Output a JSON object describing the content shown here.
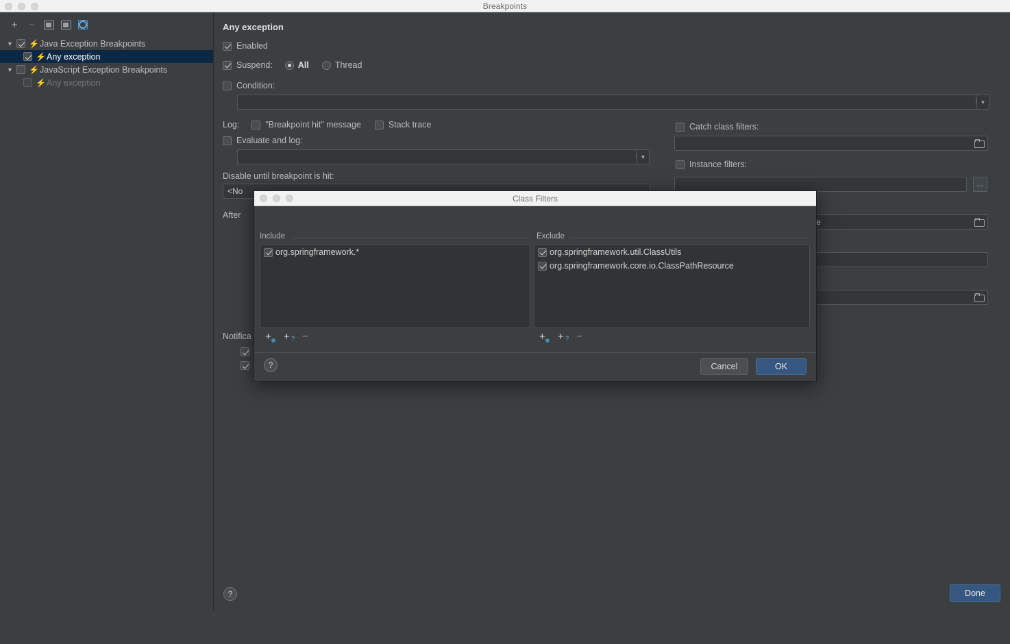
{
  "window": {
    "title": "Breakpoints",
    "traffic_lights": [
      "close-dot",
      "minimize-dot",
      "maximize-dot"
    ],
    "done_label": "Done",
    "help_label": "?"
  },
  "sidebar": {
    "toolbar": [
      {
        "name": "add-breakpoint-button",
        "glyph": "+"
      },
      {
        "name": "remove-breakpoint-button",
        "glyph": "−"
      },
      {
        "name": "group-by-icon",
        "glyph": ""
      },
      {
        "name": "save-icon",
        "glyph": ""
      },
      {
        "name": "view-options-icon",
        "glyph": ""
      }
    ],
    "tree": [
      {
        "label": "Java Exception Breakpoints",
        "level": 0,
        "expanded": true,
        "checked": true,
        "selected": false,
        "enabled": true
      },
      {
        "label": "Any exception",
        "level": 1,
        "expanded": false,
        "checked": true,
        "selected": true,
        "enabled": true
      },
      {
        "label": "JavaScript Exception Breakpoints",
        "level": 0,
        "expanded": true,
        "checked": false,
        "selected": false,
        "enabled": true
      },
      {
        "label": "Any exception",
        "level": 1,
        "expanded": false,
        "checked": false,
        "selected": false,
        "enabled": false
      }
    ]
  },
  "detail": {
    "title": "Any exception",
    "enabled": {
      "label": "Enabled",
      "checked": true
    },
    "suspend": {
      "label": "Suspend:",
      "checked": true,
      "options": [
        {
          "label": "All",
          "selected": true
        },
        {
          "label": "Thread",
          "selected": false
        }
      ]
    },
    "condition": {
      "label": "Condition:",
      "checked": false,
      "value": "",
      "expand_icon": "expand-icon",
      "dropdown_icon": "chevron-down-icon"
    },
    "log": {
      "label": "Log:",
      "breakpoint_hit": {
        "label": "\"Breakpoint hit\" message",
        "checked": false
      },
      "stack_trace": {
        "label": "Stack trace",
        "checked": false
      },
      "evaluate_and_log": {
        "label": "Evaluate and log:",
        "checked": false,
        "value": ""
      }
    },
    "disable_until": {
      "label": "Disable until breakpoint is hit:",
      "value": "<No"
    },
    "after_label": "After",
    "notifications_label": "Notifica",
    "notification_checks": [
      true,
      true
    ],
    "catch_class_filters": {
      "label": "Catch class filters:",
      "checked": false,
      "value": "",
      "browse_icon": "folder-icon"
    },
    "instance_filters": {
      "label": "Instance filters:",
      "checked": false,
      "value": "",
      "browse_label": "..."
    },
    "class_filters_field": {
      "value": "framework.core.io.ClassPathResource",
      "browse_icon": "folder-icon"
    }
  },
  "dialog": {
    "title": "Class Filters",
    "traffic_lights": [
      "close-dot",
      "minimize-dot",
      "maximize-dot"
    ],
    "include": {
      "header": "Include",
      "items": [
        {
          "label": "org.springframework.*",
          "checked": true
        }
      ],
      "toolbar": [
        {
          "name": "add-class-filter-icon",
          "glyph": "+",
          "sub": ""
        },
        {
          "name": "add-pattern-filter-icon",
          "glyph": "+",
          "sub": "?"
        },
        {
          "name": "remove-filter-icon",
          "glyph": "−",
          "sub": ""
        }
      ]
    },
    "exclude": {
      "header": "Exclude",
      "items": [
        {
          "label": "org.springframework.util.ClassUtils",
          "checked": true
        },
        {
          "label": "org.springframework.core.io.ClassPathResource",
          "checked": true
        }
      ],
      "toolbar": [
        {
          "name": "add-class-filter-icon",
          "glyph": "+",
          "sub": ""
        },
        {
          "name": "add-pattern-filter-icon",
          "glyph": "+",
          "sub": "?"
        },
        {
          "name": "remove-filter-icon",
          "glyph": "−",
          "sub": ""
        }
      ]
    },
    "help_label": "?",
    "cancel_label": "Cancel",
    "ok_label": "OK"
  },
  "colors": {
    "background": "#3c3f41",
    "selection": "#0d2845",
    "accent": "#365880",
    "bolt": "#db4b4b",
    "titlebar": "#f2f2f2"
  }
}
